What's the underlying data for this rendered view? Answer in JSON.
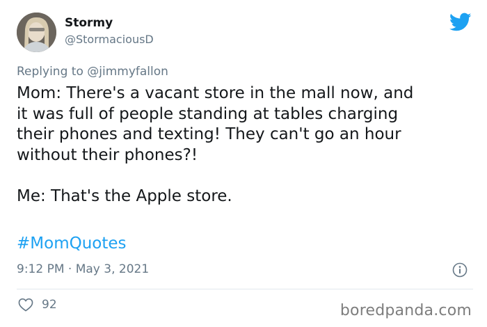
{
  "author": {
    "display_name": "Stormy",
    "handle": "@StormaciousD"
  },
  "reply": {
    "prefix": "Replying to",
    "mention": "@jimmyfallon"
  },
  "tweet": {
    "text": "Mom: There's a vacant store in the mall now, and\nit was full of people standing at tables charging\ntheir phones and texting! They can't go an hour\nwithout their phones?!\n\nMe: That's the Apple store.",
    "hashtag": "#MomQuotes",
    "timestamp": "9:12 PM · May 3, 2021",
    "like_count": "92"
  },
  "watermark": "boredpanda.com",
  "colors": {
    "twitter_blue": "#1da1f2",
    "secondary_text": "#657786",
    "divider": "#e1e8ed"
  },
  "icons": {
    "brand": "twitter-bird-icon",
    "info": "info-icon",
    "like": "heart-icon"
  }
}
